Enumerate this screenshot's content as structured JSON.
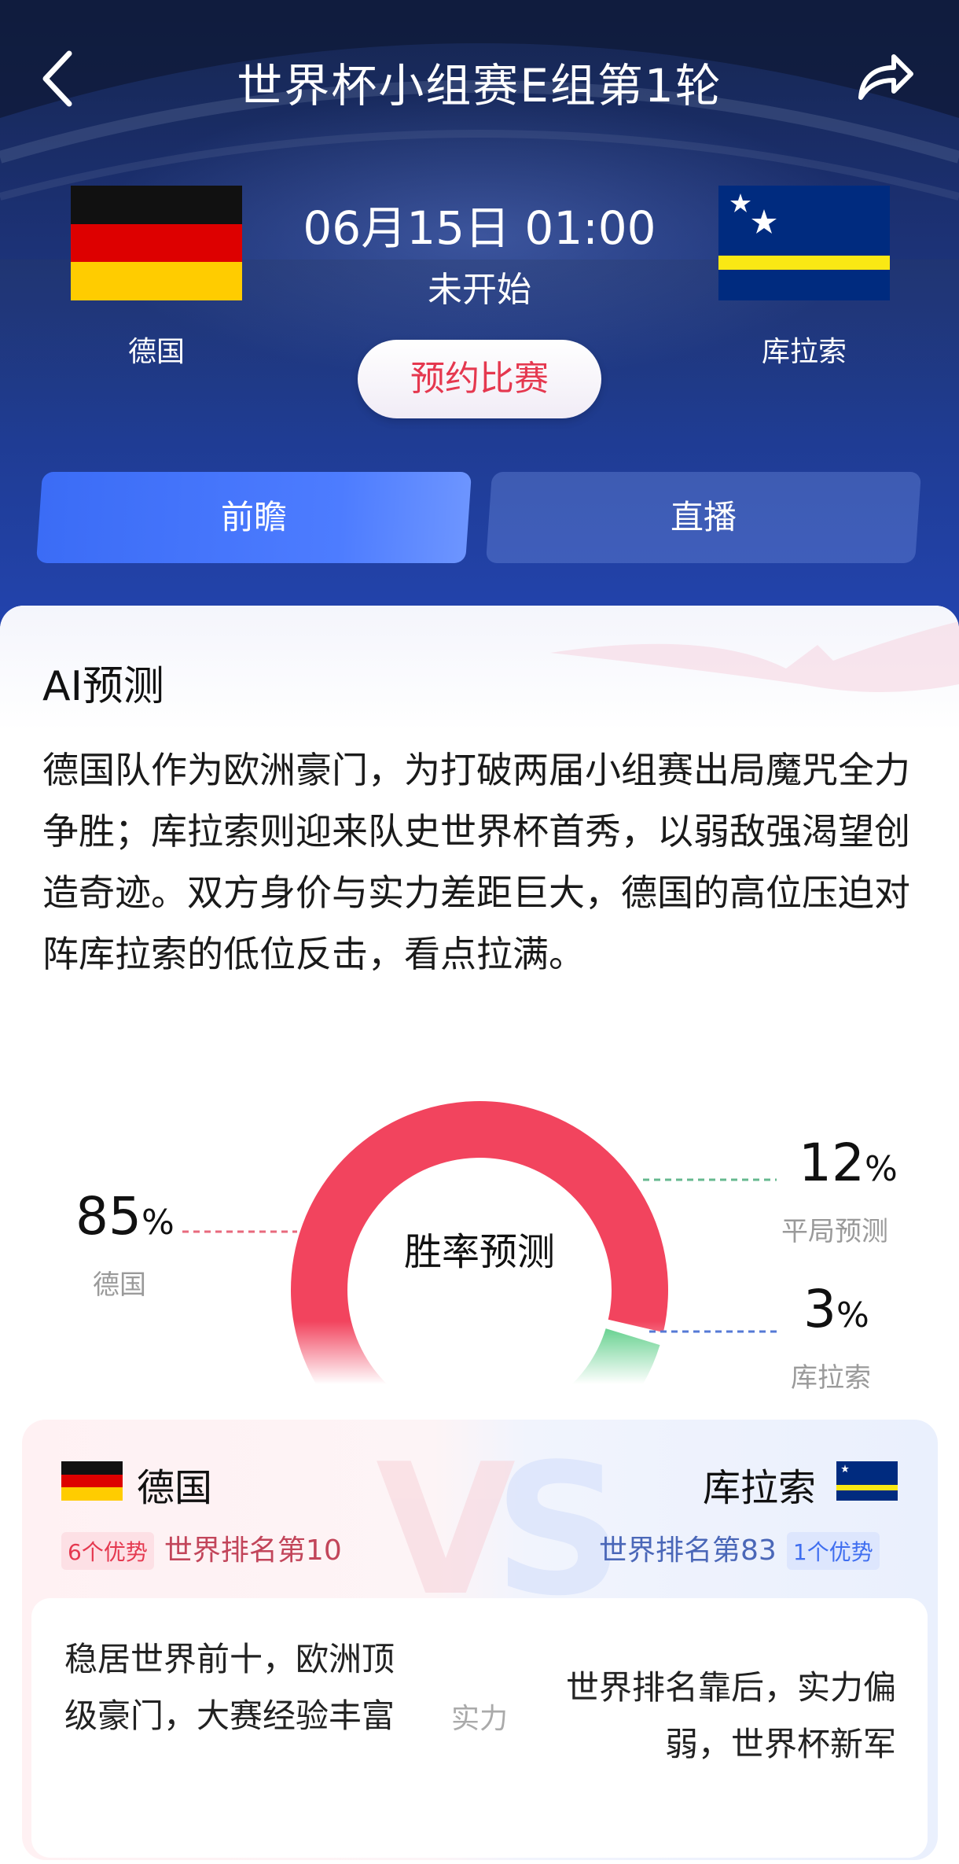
{
  "header": {
    "title": "世界杯小组赛E组第1轮",
    "back_icon": "chevron-left-icon",
    "share_icon": "share-icon"
  },
  "match": {
    "datetime": "06月15日 01:00",
    "status": "未开始",
    "reserve_label": "预约比赛",
    "home": {
      "name": "德国",
      "flag": "germany-flag"
    },
    "away": {
      "name": "库拉索",
      "flag": "curacao-flag"
    }
  },
  "tabs": [
    {
      "label": "前瞻",
      "active": true
    },
    {
      "label": "直播",
      "active": false
    }
  ],
  "ai": {
    "title": "AI预测",
    "analysis": "德国队作为欧洲豪门，为打破两届小组赛出局魔咒全力争胜；库拉索则迎来队史世界杯首秀，以弱敌强渴望创造奇迹。双方身价与实力差距巨大，德国的高位压迫对阵库拉索的低位反击，看点拉满。"
  },
  "chart_data": {
    "type": "pie",
    "title": "胜率预测",
    "unit": "%",
    "slices": [
      {
        "name": "德国",
        "value": 85,
        "color": "#f2445e"
      },
      {
        "name": "平局预测",
        "value": 12,
        "color": "#56cc83"
      },
      {
        "name": "库拉索",
        "value": 3,
        "color": "#3f6ef0"
      }
    ]
  },
  "comparison": {
    "home": {
      "name": "德国",
      "advantages": "6个优势",
      "rank": "世界排名第10"
    },
    "away": {
      "name": "库拉索",
      "advantages": "1个优势",
      "rank": "世界排名第83"
    },
    "rows": [
      {
        "category": "实力",
        "home": "稳居世界前十，欧洲顶级豪门，大赛经验丰富",
        "away": "世界排名靠后，实力偏弱，世界杯新军"
      }
    ]
  },
  "colors": {
    "accent_red": "#e5384f",
    "accent_blue": "#3f6ef0",
    "hero_blue": "#1e3a8c"
  }
}
